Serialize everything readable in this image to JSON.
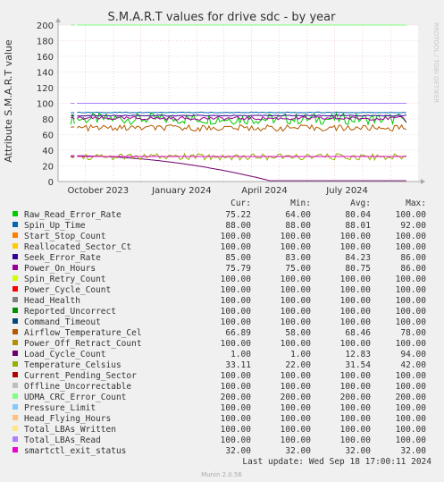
{
  "chart_data": {
    "type": "line",
    "title": "S.M.A.R.T values for drive sdc - by year",
    "ylabel": "Attribute S.M.A.R.T value",
    "ylim": [
      0,
      200
    ],
    "yticks": [
      0,
      20,
      40,
      60,
      80,
      100,
      120,
      140,
      160,
      180,
      200
    ],
    "xlim": [
      "2023-09-01",
      "2024-10-01"
    ],
    "xticks": [
      {
        "label": "October 2023",
        "date": "2023-10-15"
      },
      {
        "label": "January 2024",
        "date": "2024-01-15"
      },
      {
        "label": "April 2024",
        "date": "2024-04-15"
      },
      {
        "label": "July 2024",
        "date": "2024-07-15"
      }
    ],
    "grid": true,
    "legend_position": "bottom",
    "columns": [
      "Cur:",
      "Min:",
      "Avg:",
      "Max:"
    ],
    "series": [
      {
        "name": "Raw_Read_Error_Rate",
        "color": "#00cc00",
        "cur": "75.22",
        "min": "64.00",
        "avg": "80.04",
        "max": "100.00"
      },
      {
        "name": "Spin_Up_Time",
        "color": "#0066b3",
        "cur": "88.00",
        "min": "88.00",
        "avg": "88.01",
        "max": "92.00"
      },
      {
        "name": "Start_Stop_Count",
        "color": "#ff8000",
        "cur": "100.00",
        "min": "100.00",
        "avg": "100.00",
        "max": "100.00"
      },
      {
        "name": "Reallocated_Sector_Ct",
        "color": "#ffcc00",
        "cur": "100.00",
        "min": "100.00",
        "avg": "100.00",
        "max": "100.00"
      },
      {
        "name": "Seek_Error_Rate",
        "color": "#330099",
        "cur": "85.00",
        "min": "83.00",
        "avg": "84.23",
        "max": "86.00"
      },
      {
        "name": "Power_On_Hours",
        "color": "#990099",
        "cur": "75.79",
        "min": "75.00",
        "avg": "80.75",
        "max": "86.00"
      },
      {
        "name": "Spin_Retry_Count",
        "color": "#ccff00",
        "cur": "100.00",
        "min": "100.00",
        "avg": "100.00",
        "max": "100.00"
      },
      {
        "name": "Power_Cycle_Count",
        "color": "#ff0000",
        "cur": "100.00",
        "min": "100.00",
        "avg": "100.00",
        "max": "100.00"
      },
      {
        "name": "Head_Health",
        "color": "#808080",
        "cur": "100.00",
        "min": "100.00",
        "avg": "100.00",
        "max": "100.00"
      },
      {
        "name": "Reported_Uncorrect",
        "color": "#008f00",
        "cur": "100.00",
        "min": "100.00",
        "avg": "100.00",
        "max": "100.00"
      },
      {
        "name": "Command_Timeout",
        "color": "#00487d",
        "cur": "100.00",
        "min": "100.00",
        "avg": "100.00",
        "max": "100.00"
      },
      {
        "name": "Airflow_Temperature_Cel",
        "color": "#b35a00",
        "cur": "66.89",
        "min": "58.00",
        "avg": "68.46",
        "max": "78.00"
      },
      {
        "name": "Power_Off_Retract_Count",
        "color": "#b38f00",
        "cur": "100.00",
        "min": "100.00",
        "avg": "100.00",
        "max": "100.00"
      },
      {
        "name": "Load_Cycle_Count",
        "color": "#6b006b",
        "cur": "1.00",
        "min": "1.00",
        "avg": "12.83",
        "max": "94.00"
      },
      {
        "name": "Temperature_Celsius",
        "color": "#8fb300",
        "cur": "33.11",
        "min": "22.00",
        "avg": "31.54",
        "max": "42.00"
      },
      {
        "name": "Current_Pending_Sector",
        "color": "#b30000",
        "cur": "100.00",
        "min": "100.00",
        "avg": "100.00",
        "max": "100.00"
      },
      {
        "name": "Offline_Uncorrectable",
        "color": "#bebebe",
        "cur": "100.00",
        "min": "100.00",
        "avg": "100.00",
        "max": "100.00"
      },
      {
        "name": "UDMA_CRC_Error_Count",
        "color": "#80ff80",
        "cur": "200.00",
        "min": "200.00",
        "avg": "200.00",
        "max": "200.00"
      },
      {
        "name": "Pressure_Limit",
        "color": "#80c9ff",
        "cur": "100.00",
        "min": "100.00",
        "avg": "100.00",
        "max": "100.00"
      },
      {
        "name": "Head_Flying_Hours",
        "color": "#ffc080",
        "cur": "100.00",
        "min": "100.00",
        "avg": "100.00",
        "max": "100.00"
      },
      {
        "name": "Total_LBAs_Written",
        "color": "#ffe680",
        "cur": "100.00",
        "min": "100.00",
        "avg": "100.00",
        "max": "100.00"
      },
      {
        "name": "Total_LBAs_Read",
        "color": "#aa80ff",
        "cur": "100.00",
        "min": "100.00",
        "avg": "100.00",
        "max": "100.00"
      },
      {
        "name": "smartctl_exit_status",
        "color": "#ee00cc",
        "cur": "32.00",
        "min": "32.00",
        "avg": "32.00",
        "max": "32.00"
      }
    ],
    "last_update": "Last update: Wed Sep 18 17:00:11 2024",
    "side_label": "RRDTOOL / TOBI OETIKER",
    "footer": "Munin 2.0.56"
  }
}
